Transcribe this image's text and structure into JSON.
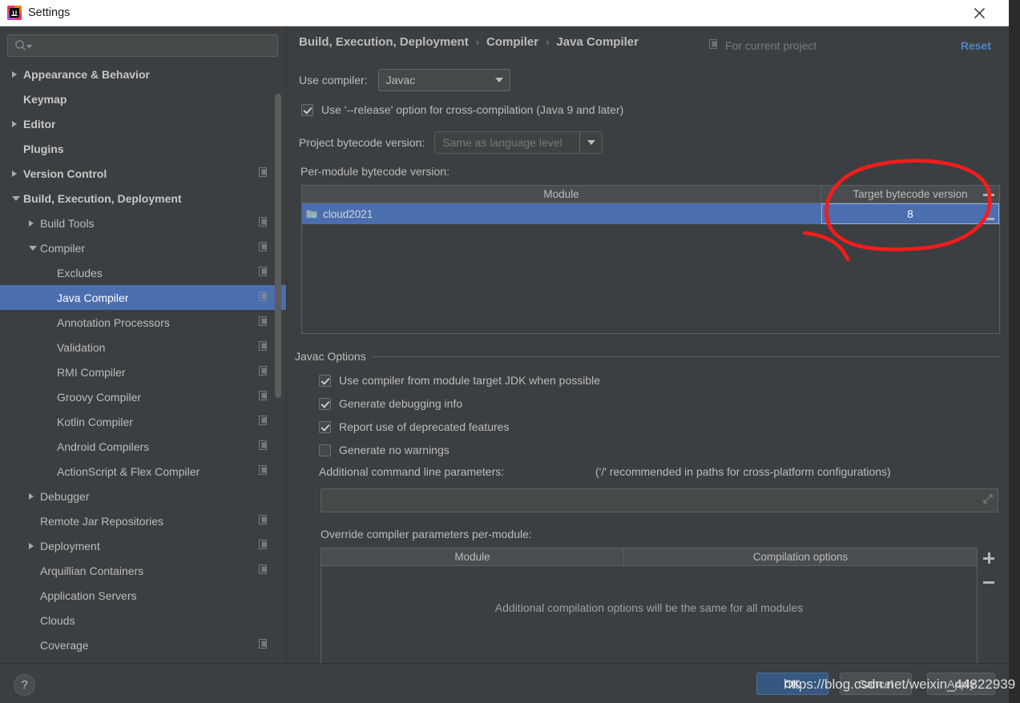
{
  "window": {
    "title": "Settings",
    "logo_icon": "intellij-idea-logo",
    "logo_text": "IJ",
    "close_icon": "close-icon"
  },
  "sidebar": {
    "search": {
      "placeholder": "",
      "value": "",
      "icon": "search-icon"
    },
    "items": [
      {
        "label": "Appearance & Behavior",
        "indent": 0,
        "arrow": "collapsed",
        "bold": true,
        "copy": false,
        "selected": false
      },
      {
        "label": "Keymap",
        "indent": 0,
        "arrow": "none",
        "bold": true,
        "copy": false,
        "selected": false
      },
      {
        "label": "Editor",
        "indent": 0,
        "arrow": "collapsed",
        "bold": true,
        "copy": false,
        "selected": false
      },
      {
        "label": "Plugins",
        "indent": 0,
        "arrow": "none",
        "bold": true,
        "copy": false,
        "selected": false
      },
      {
        "label": "Version Control",
        "indent": 0,
        "arrow": "collapsed",
        "bold": true,
        "copy": true,
        "selected": false
      },
      {
        "label": "Build, Execution, Deployment",
        "indent": 0,
        "arrow": "expanded",
        "bold": true,
        "copy": false,
        "selected": false
      },
      {
        "label": "Build Tools",
        "indent": 1,
        "arrow": "collapsed",
        "bold": false,
        "copy": true,
        "selected": false
      },
      {
        "label": "Compiler",
        "indent": 1,
        "arrow": "expanded",
        "bold": false,
        "copy": true,
        "selected": false
      },
      {
        "label": "Excludes",
        "indent": 2,
        "arrow": "none",
        "bold": false,
        "copy": true,
        "selected": false
      },
      {
        "label": "Java Compiler",
        "indent": 2,
        "arrow": "none",
        "bold": false,
        "copy": true,
        "selected": true
      },
      {
        "label": "Annotation Processors",
        "indent": 2,
        "arrow": "none",
        "bold": false,
        "copy": true,
        "selected": false
      },
      {
        "label": "Validation",
        "indent": 2,
        "arrow": "none",
        "bold": false,
        "copy": true,
        "selected": false
      },
      {
        "label": "RMI Compiler",
        "indent": 2,
        "arrow": "none",
        "bold": false,
        "copy": true,
        "selected": false
      },
      {
        "label": "Groovy Compiler",
        "indent": 2,
        "arrow": "none",
        "bold": false,
        "copy": true,
        "selected": false
      },
      {
        "label": "Kotlin Compiler",
        "indent": 2,
        "arrow": "none",
        "bold": false,
        "copy": true,
        "selected": false
      },
      {
        "label": "Android Compilers",
        "indent": 2,
        "arrow": "none",
        "bold": false,
        "copy": true,
        "selected": false
      },
      {
        "label": "ActionScript & Flex Compiler",
        "indent": 2,
        "arrow": "none",
        "bold": false,
        "copy": true,
        "selected": false
      },
      {
        "label": "Debugger",
        "indent": 1,
        "arrow": "collapsed",
        "bold": false,
        "copy": false,
        "selected": false
      },
      {
        "label": "Remote Jar Repositories",
        "indent": 1,
        "arrow": "none",
        "bold": false,
        "copy": true,
        "selected": false
      },
      {
        "label": "Deployment",
        "indent": 1,
        "arrow": "collapsed",
        "bold": false,
        "copy": true,
        "selected": false
      },
      {
        "label": "Arquillian Containers",
        "indent": 1,
        "arrow": "none",
        "bold": false,
        "copy": true,
        "selected": false
      },
      {
        "label": "Application Servers",
        "indent": 1,
        "arrow": "none",
        "bold": false,
        "copy": false,
        "selected": false
      },
      {
        "label": "Clouds",
        "indent": 1,
        "arrow": "none",
        "bold": false,
        "copy": false,
        "selected": false
      },
      {
        "label": "Coverage",
        "indent": 1,
        "arrow": "none",
        "bold": false,
        "copy": true,
        "selected": false
      }
    ]
  },
  "header": {
    "breadcrumb": [
      "Build, Execution, Deployment",
      "Compiler",
      "Java Compiler"
    ],
    "separator": "›",
    "scope_label": "For current project",
    "scope_icon": "copy-icon",
    "reset_label": "Reset"
  },
  "main": {
    "use_compiler_label": "Use compiler:",
    "use_compiler_value": "Javac",
    "release_option_label": "Use '--release' option for cross-compilation (Java 9 and later)",
    "release_option_checked": true,
    "project_bytecode_label": "Project bytecode version:",
    "project_bytecode_value": "Same as language level",
    "per_module_label": "Per-module bytecode version:",
    "module_table": {
      "columns": [
        "Module",
        "Target bytecode version"
      ],
      "rows": [
        {
          "module": "cloud2021",
          "target": "8",
          "selected": true,
          "editing": true,
          "icon": "module-icon"
        }
      ],
      "add_icon": "plus-icon",
      "remove_icon": "minus-icon"
    },
    "javac_options": {
      "title": "Javac Options",
      "checkboxes": [
        {
          "label": "Use compiler from module target JDK when possible",
          "checked": true
        },
        {
          "label": "Generate debugging info",
          "checked": true
        },
        {
          "label": "Report use of deprecated features",
          "checked": true
        },
        {
          "label": "Generate no warnings",
          "checked": false
        }
      ],
      "additional_params_label": "Additional command line parameters:",
      "additional_params_hint": "('/' recommended in paths for cross-platform configurations)",
      "additional_params_value": "",
      "expand_icon": "expand-icon"
    },
    "override_label": "Override compiler parameters per-module:",
    "override_table": {
      "columns": [
        "Module",
        "Compilation options"
      ],
      "empty_message": "Additional compilation options will be the same for all modules",
      "add_icon": "plus-icon",
      "remove_icon": "minus-icon"
    }
  },
  "footer": {
    "help_label": "?",
    "ok_label": "OK",
    "cancel_label": "Cancel",
    "apply_label": "Apply"
  },
  "watermark": {
    "text": "https://blog.csdn.net/weixin_44822939"
  },
  "annotation": {
    "shape": "red-ellipse-highlight",
    "color": "#f81b1b"
  },
  "colors": {
    "background": "#3c3f41",
    "selection": "#4b6eaf",
    "accent_link": "#4a88c7",
    "primary_button": "#365880",
    "titlebar": "#ffffff"
  }
}
